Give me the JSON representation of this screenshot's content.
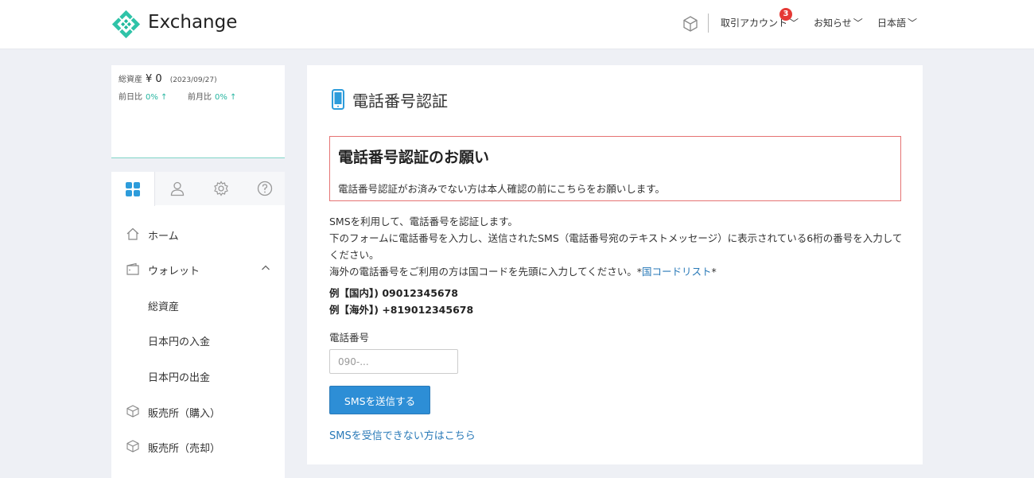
{
  "header": {
    "logo_text": "Exchange",
    "menus": [
      {
        "label": "取引アカウント",
        "badge": "3"
      },
      {
        "label": "お知らせ"
      },
      {
        "label": "日本語"
      }
    ],
    "chevron": "﹀"
  },
  "asset": {
    "total_label": "総資産",
    "total_value": "¥ 0",
    "date": "(2023/09/27)",
    "day_label": "前日比",
    "day_value": "0% ↑",
    "month_label": "前月比",
    "month_value": "0% ↑"
  },
  "sidebar": {
    "tabs": [
      "grid-icon",
      "user-icon",
      "gear-icon",
      "help-icon"
    ],
    "items": [
      {
        "label": "ホーム",
        "icon": "home-icon"
      },
      {
        "label": "ウォレット",
        "icon": "wallet-icon"
      },
      {
        "label": "総資産"
      },
      {
        "label": "日本円の入金"
      },
      {
        "label": "日本円の出金"
      },
      {
        "label": "販売所（購入）",
        "icon": "box-icon"
      },
      {
        "label": "販売所（売却）",
        "icon": "box-icon"
      }
    ]
  },
  "main": {
    "title": "電話番号認証",
    "notice_title": "電話番号認証のお願い",
    "notice_body": "電話番号認証がお済みでない方は本人確認の前にこちらをお願いします。",
    "desc1": "SMSを利用して、電話番号を認証します。",
    "desc2": "下のフォームに電話番号を入力し、送信されたSMS（電話番号宛のテキストメッセージ）に表示されている6桁の番号を入力してください。",
    "desc3_pre": "海外の電話番号をご利用の方は国コードを先頭に入力してください。*",
    "desc3_link": "国コードリスト",
    "desc3_post": "*",
    "example_domestic": "例【国内】) 09012345678",
    "example_overseas": "例【海外】) +819012345678",
    "phone_label": "電話番号",
    "phone_placeholder": "090-...",
    "phone_value": "",
    "send_button": "SMSを送信する",
    "help_link": "SMSを受信できない方はこちら"
  },
  "colors": {
    "accent": "#2d8ed6",
    "link": "#2a7ab8",
    "positive": "#26b5a0",
    "notice_border": "#e57373",
    "badge": "#e53935"
  }
}
